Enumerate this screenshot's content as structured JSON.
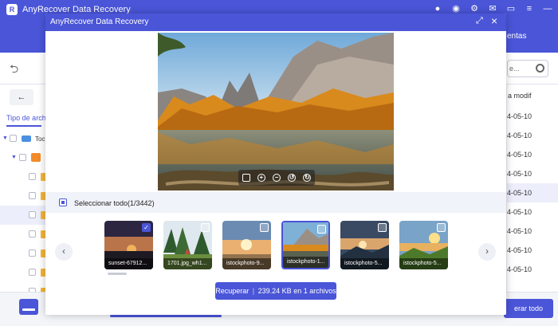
{
  "app": {
    "title": "AnyRecover Data Recovery",
    "right_tab_fragment": "entas",
    "undo_glyph": "⮌"
  },
  "background": {
    "tab_label": "Tipo de arch",
    "tree_root": "Toc",
    "search_placeholder": "e...",
    "column_header": "a modif",
    "dates": [
      "4-05-10",
      "4-05-10",
      "4-05-10",
      "4-05-10",
      "4-05-10",
      "4-05-10",
      "4-05-10",
      "4-05-10",
      "4-05-10",
      "4-05-10"
    ],
    "recover_all": "erar todo"
  },
  "modal": {
    "title": "AnyRecover Data Recovery",
    "select_all": "Seleccionar todo(1/3442)",
    "recover_label": "Recuperar",
    "recover_separator": "|",
    "recover_detail": "239.24 KB en 1 archivos",
    "thumbnails": [
      {
        "name": "sunset-67912...",
        "checked": true
      },
      {
        "name": "1701.jpg_wh1...",
        "checked": false
      },
      {
        "name": "istockphoto-9...",
        "checked": false
      },
      {
        "name": "istockphoto-1...",
        "checked": false
      },
      {
        "name": "istockphoto-5...",
        "checked": false
      },
      {
        "name": "istockphoto-5...",
        "checked": false
      }
    ]
  },
  "colors": {
    "accent": "#4a55d8",
    "folder": "#f4b53b",
    "highlight": "#eceefb"
  }
}
